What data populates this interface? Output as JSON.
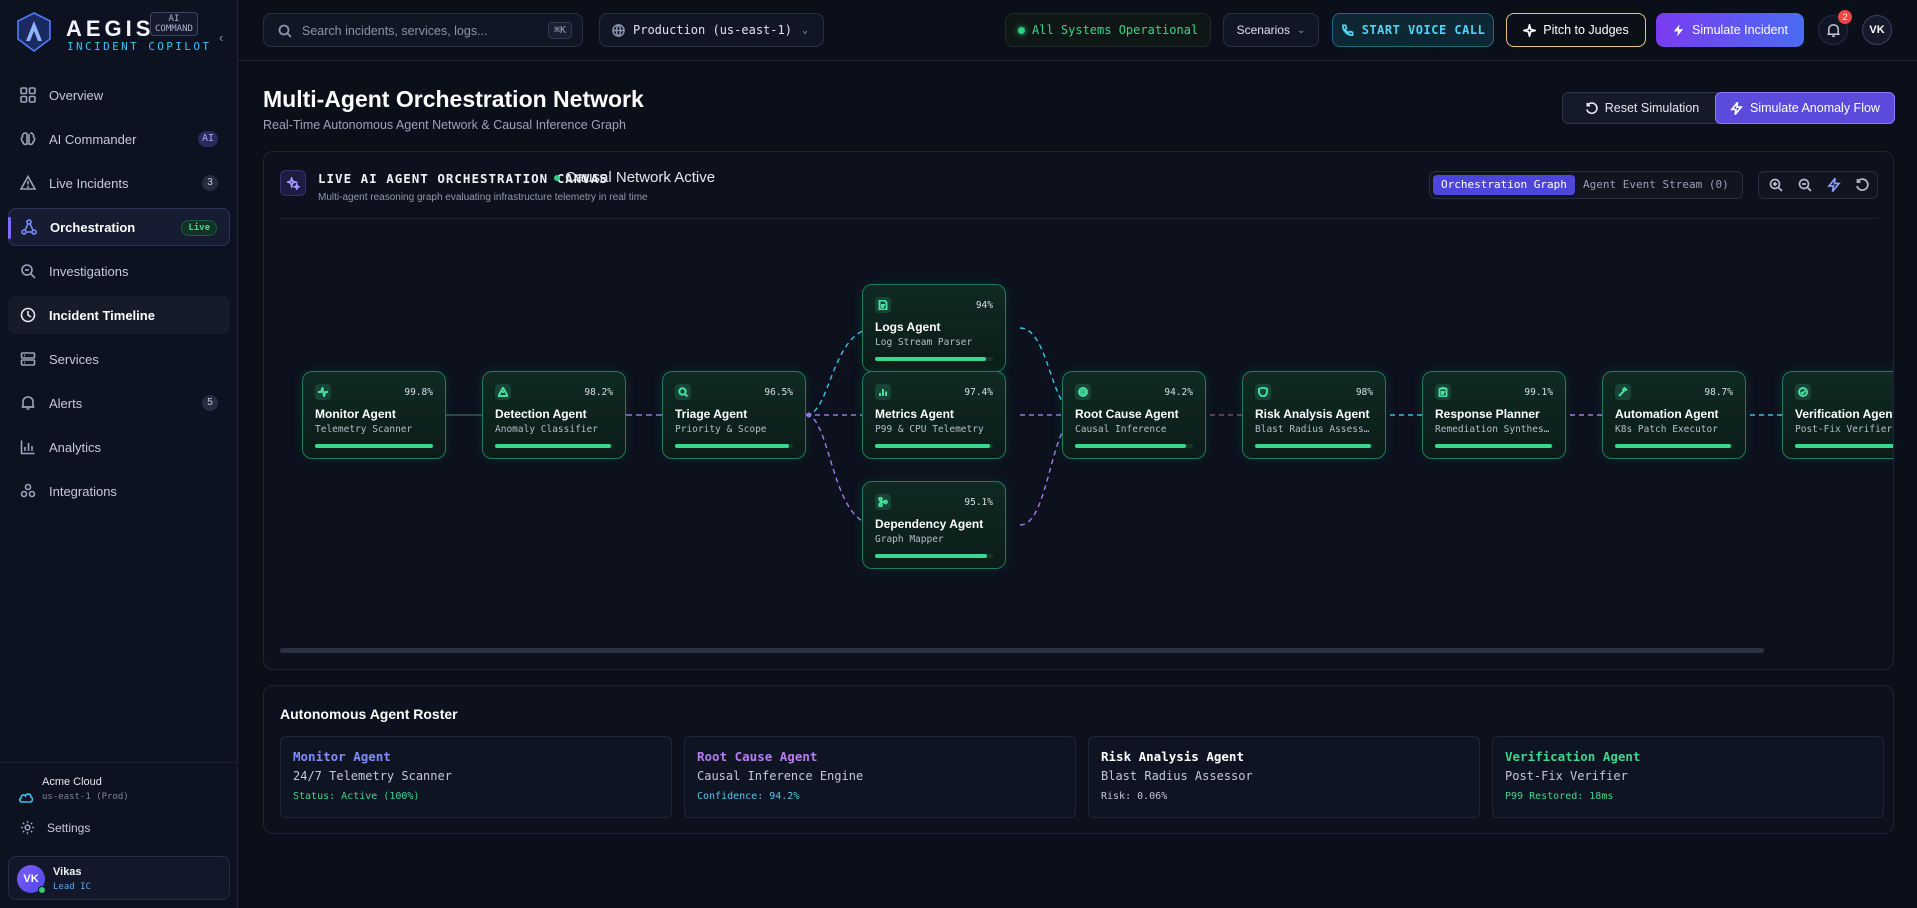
{
  "brand": {
    "name": "AEGIS",
    "badge_line1": "AI",
    "badge_line2": "COMMAND",
    "subtitle": "INCIDENT COPILOT"
  },
  "sidebar": {
    "items": [
      {
        "label": "Overview",
        "icon": "grid-icon"
      },
      {
        "label": "AI Commander",
        "icon": "brain-icon",
        "badge": "AI"
      },
      {
        "label": "Live Incidents",
        "icon": "alert-triangle-icon",
        "badge": "3"
      },
      {
        "label": "Orchestration",
        "icon": "network-icon",
        "badge": "Live"
      },
      {
        "label": "Investigations",
        "icon": "search-scan-icon"
      },
      {
        "label": "Incident Timeline",
        "icon": "clock-icon"
      },
      {
        "label": "Services",
        "icon": "server-icon"
      },
      {
        "label": "Alerts",
        "icon": "bell-icon",
        "badge": "5"
      },
      {
        "label": "Analytics",
        "icon": "bar-chart-icon"
      },
      {
        "label": "Integrations",
        "icon": "puzzle-icon"
      }
    ],
    "org": {
      "name": "Acme Cloud",
      "region": "us-east-1 (Prod)"
    },
    "settings_label": "Settings",
    "user": {
      "initials": "VK",
      "name": "Vikas",
      "role": "Lead IC"
    }
  },
  "topbar": {
    "search_placeholder": "Search incidents, services, logs...",
    "search_shortcut": "⌘K",
    "environment": "Production (us-east-1)",
    "system_status": "All Systems Operational",
    "scenarios_label": "Scenarios",
    "voice_label": "START VOICE CALL",
    "pitch_label": "Pitch to Judges",
    "simulate_label": "Simulate Incident",
    "notifications": "2",
    "avatar_initials": "VK"
  },
  "page": {
    "title": "Multi-Agent Orchestration Network",
    "subtitle": "Real-Time Autonomous Agent Network & Causal Inference Graph",
    "reset_label": "Reset Simulation",
    "anomaly_label": "Simulate Anomaly Flow"
  },
  "canvas": {
    "title": "LIVE AI AGENT ORCHESTRATION CANVAS",
    "status": "Causal Network Active",
    "description": "Multi-agent reasoning graph evaluating infrastructure telemetry in real time",
    "tabs": [
      "Orchestration Graph",
      "Agent Event Stream (0)"
    ],
    "colors": {
      "node_border": "#1f7b5a",
      "edge_cyan": "#33c4e6",
      "edge_purple": "#a776f0",
      "bar_fill": "#38d98e"
    }
  },
  "agents": [
    {
      "name": "Monitor Agent",
      "role": "Telemetry Scanner",
      "confidence": "99.8%",
      "progress": 0.998,
      "icon": "activity-icon"
    },
    {
      "name": "Detection Agent",
      "role": "Anomaly Classifier",
      "confidence": "98.2%",
      "progress": 0.982,
      "icon": "warning-icon"
    },
    {
      "name": "Triage Agent",
      "role": "Priority & Scope",
      "confidence": "96.5%",
      "progress": 0.965,
      "icon": "scan-icon"
    },
    {
      "name": "Logs Agent",
      "role": "Log Stream Parser",
      "confidence": "94%",
      "progress": 0.94,
      "icon": "file-icon"
    },
    {
      "name": "Metrics Agent",
      "role": "P99 & CPU Telemetry",
      "confidence": "97.4%",
      "progress": 0.974,
      "icon": "bars-icon"
    },
    {
      "name": "Dependency Agent",
      "role": "Graph Mapper",
      "confidence": "95.1%",
      "progress": 0.951,
      "icon": "branch-icon"
    },
    {
      "name": "Root Cause Agent",
      "role": "Causal Inference",
      "confidence": "94.2%",
      "progress": 0.942,
      "icon": "target-icon"
    },
    {
      "name": "Risk Analysis Agent",
      "role": "Blast Radius Assessor",
      "confidence": "98%",
      "progress": 0.98,
      "icon": "shield-icon"
    },
    {
      "name": "Response Planner",
      "role": "Remediation Synthesizer",
      "confidence": "99.1%",
      "progress": 0.991,
      "icon": "clipboard-icon"
    },
    {
      "name": "Automation Agent",
      "role": "K8s Patch Executor",
      "confidence": "98.7%",
      "progress": 0.987,
      "icon": "wrench-icon"
    },
    {
      "name": "Verification Agent",
      "role": "Post-Fix Verifier",
      "confidence": "",
      "progress": 0.99,
      "icon": "check-circle-icon"
    }
  ],
  "roster": {
    "title": "Autonomous Agent Roster",
    "cards": [
      {
        "name": "Monitor Agent",
        "role": "24/7 Telemetry Scanner",
        "stat": "Status: Active (100%)",
        "name_color": "#7f8cff",
        "stat_color": "#3fd58c"
      },
      {
        "name": "Root Cause Agent",
        "role": "Causal Inference Engine",
        "stat": "Confidence: 94.2%",
        "name_color": "#b77cf4",
        "stat_color": "#4ec9ef"
      },
      {
        "name": "Risk Analysis Agent",
        "role": "Blast Radius Assessor",
        "stat": "Risk: 0.06%",
        "name_color": "#ffffff",
        "stat_color": "#c3c8d6"
      },
      {
        "name": "Verification Agent",
        "role": "Post-Fix Verifier",
        "stat": "P99 Restored: 18ms",
        "name_color": "#3fd58c",
        "stat_color": "#3fd58c"
      }
    ]
  }
}
